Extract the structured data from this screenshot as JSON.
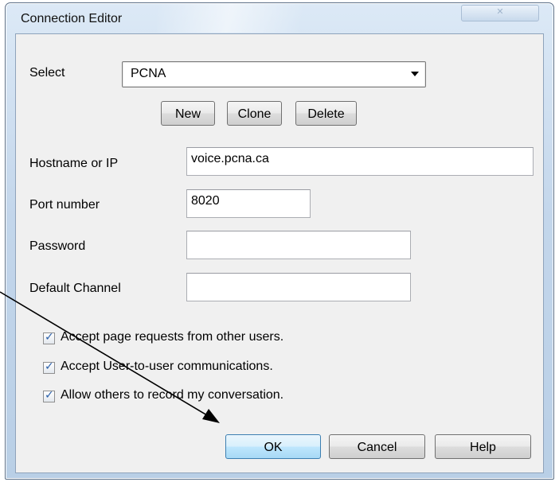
{
  "window": {
    "title": "Connection Editor",
    "close_glyph": "✕"
  },
  "select": {
    "label": "Select",
    "value": "PCNA"
  },
  "buttons": {
    "new": "New",
    "clone": "Clone",
    "delete": "Delete",
    "ok": "OK",
    "cancel": "Cancel",
    "help": "Help"
  },
  "fields": {
    "hostname": {
      "label": "Hostname or IP",
      "value": "voice.pcna.ca"
    },
    "port": {
      "label": "Port number",
      "value": "8020"
    },
    "password": {
      "label": "Password",
      "value": ""
    },
    "default_channel": {
      "label": "Default Channel",
      "value": ""
    }
  },
  "checkboxes": [
    {
      "label": "Accept page requests from other users.",
      "checked": true
    },
    {
      "label": "Accept User-to-user communications.",
      "checked": true
    },
    {
      "label": "Allow others to record my conversation.",
      "checked": true
    }
  ],
  "check_glyph": "✓",
  "colors": {
    "accent_default_button": "#3c7fb1",
    "titlebar": "#c3d6eb",
    "annotation_arrow": "#000000"
  },
  "icons": {
    "combo": "chevron-down-icon",
    "annotation": "pointer-arrow-icon"
  }
}
